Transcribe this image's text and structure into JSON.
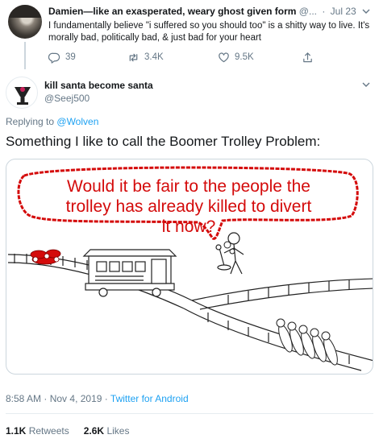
{
  "parent_tweet": {
    "name": "Damien—like an exasperated, weary ghost given form",
    "handle": "@...",
    "separator": "·",
    "date": "Jul 23",
    "text": "I fundamentally believe \"i suffered so you should too\" is a shitty way to live. It's morally bad, politically bad, & just bad for your heart",
    "replies": "39",
    "retweets": "3.4K",
    "likes": "9.5K"
  },
  "tweet": {
    "name": "kill santa become santa",
    "handle": "@Seej500",
    "replying_prefix": "Replying to",
    "replying_to": "@Wolven",
    "text": "Something I like to call the Boomer Trolley Problem:",
    "image": {
      "speech_bubble_lines": [
        "Would it be fair to the people the",
        "trolley has already killed to divert",
        "it now?"
      ],
      "bubble_color": "#d40b0b"
    },
    "time": "8:58 AM",
    "date_sep": "·",
    "date": "Nov 4, 2019",
    "client_sep": "·",
    "client": "Twitter for Android",
    "retweets_count": "1.1K",
    "retweets_label": "Retweets",
    "likes_count": "2.6K",
    "likes_label": "Likes"
  },
  "colors": {
    "link": "#1da1f2",
    "secondary_text": "#657786",
    "primary_text": "#14171a",
    "divider": "#e6ecf0"
  },
  "icons": [
    "reply-icon",
    "retweet-icon",
    "like-icon",
    "share-icon",
    "chevron-down-icon"
  ]
}
